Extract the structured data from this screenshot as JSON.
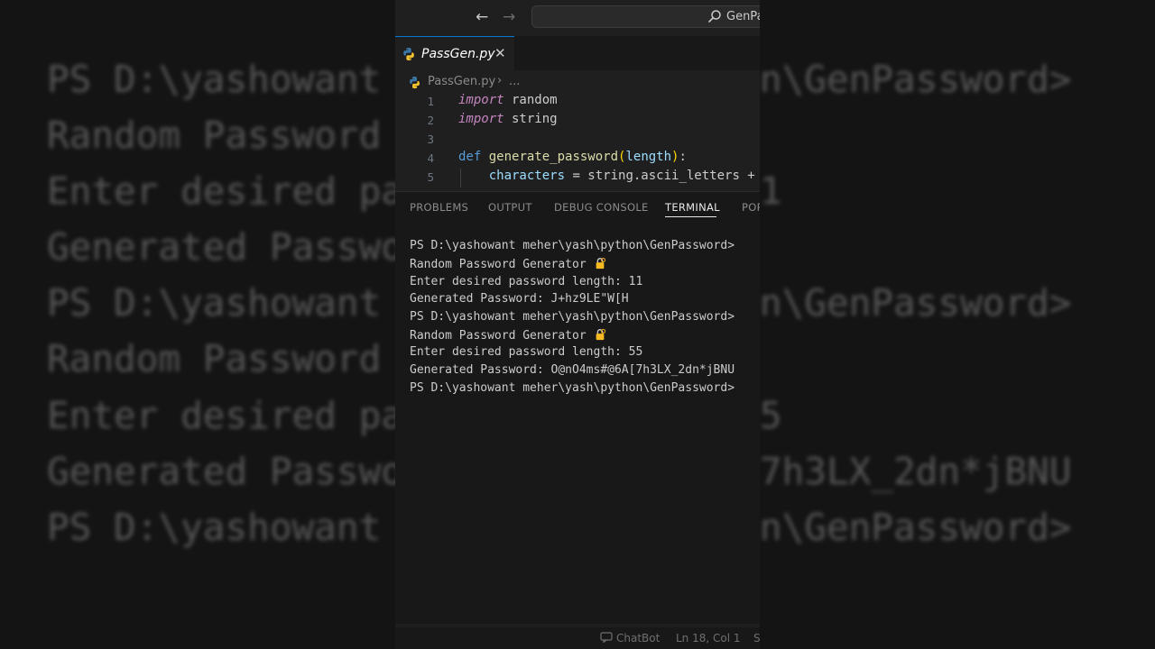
{
  "background": {
    "lines": [
      "PS D:\\yashowant meher\\yash\\python\\GenPassword>",
      "Random Password Generator",
      "Enter desired password length: 11",
      "Generated Password: J+hz9LE\"W[H",
      "PS D:\\yashowant meher\\yash\\python\\GenPassword>",
      "Random Password Generator",
      "Enter desired password length: 55",
      "Generated Password: O@nO4ms#@6A[7h3LX_2dn*jBNU",
      "PS D:\\yashowant meher\\yash\\python\\GenPassword>"
    ]
  },
  "titlebar": {
    "back_icon": "arrow-left-icon",
    "forward_icon": "arrow-right-icon",
    "search_text": "GenPa"
  },
  "tab": {
    "label": "PassGen.py",
    "icon": "python-icon",
    "close_label": "✕"
  },
  "breadcrumb": {
    "file": "PassGen.py",
    "separator": "›",
    "more": "..."
  },
  "editor": {
    "lines": [
      {
        "num": "1",
        "keyword": "import",
        "rest": " random"
      },
      {
        "num": "2",
        "keyword": "import",
        "rest": " string"
      },
      {
        "num": "3"
      },
      {
        "num": "4",
        "def": "def",
        "fn": "generate_password",
        "open": "(",
        "param": "length",
        "close": ")",
        "colon": ":"
      },
      {
        "num": "5",
        "var": "characters",
        "rest": " = string.ascii_letters +"
      }
    ]
  },
  "panel": {
    "tabs": [
      "PROBLEMS",
      "OUTPUT",
      "DEBUG CONSOLE",
      "TERMINAL",
      "POR"
    ],
    "active": "TERMINAL"
  },
  "terminal": {
    "lines": [
      "PS D:\\yashowant meher\\yash\\python\\GenPassword>",
      "Random Password Generator ",
      "Enter desired password length: 11",
      "Generated Password: J+hz9LE\"W[H",
      "PS D:\\yashowant meher\\yash\\python\\GenPassword>",
      "Random Password Generator ",
      "Enter desired password length: 55",
      "Generated Password: O@nO4ms#@6A[7h3LX_2dn*jBNU",
      "PS D:\\yashowant meher\\yash\\python\\GenPassword>"
    ],
    "lock_emoji": "lock-with-key-icon"
  },
  "statusbar": {
    "chatbot": "ChatBot",
    "position": "Ln 18, Col 1",
    "extra": "S"
  },
  "colors": {
    "accent": "#0078d4",
    "keyword": "#c586c0",
    "function": "#dcdcaa",
    "variable": "#9cdcfe"
  }
}
